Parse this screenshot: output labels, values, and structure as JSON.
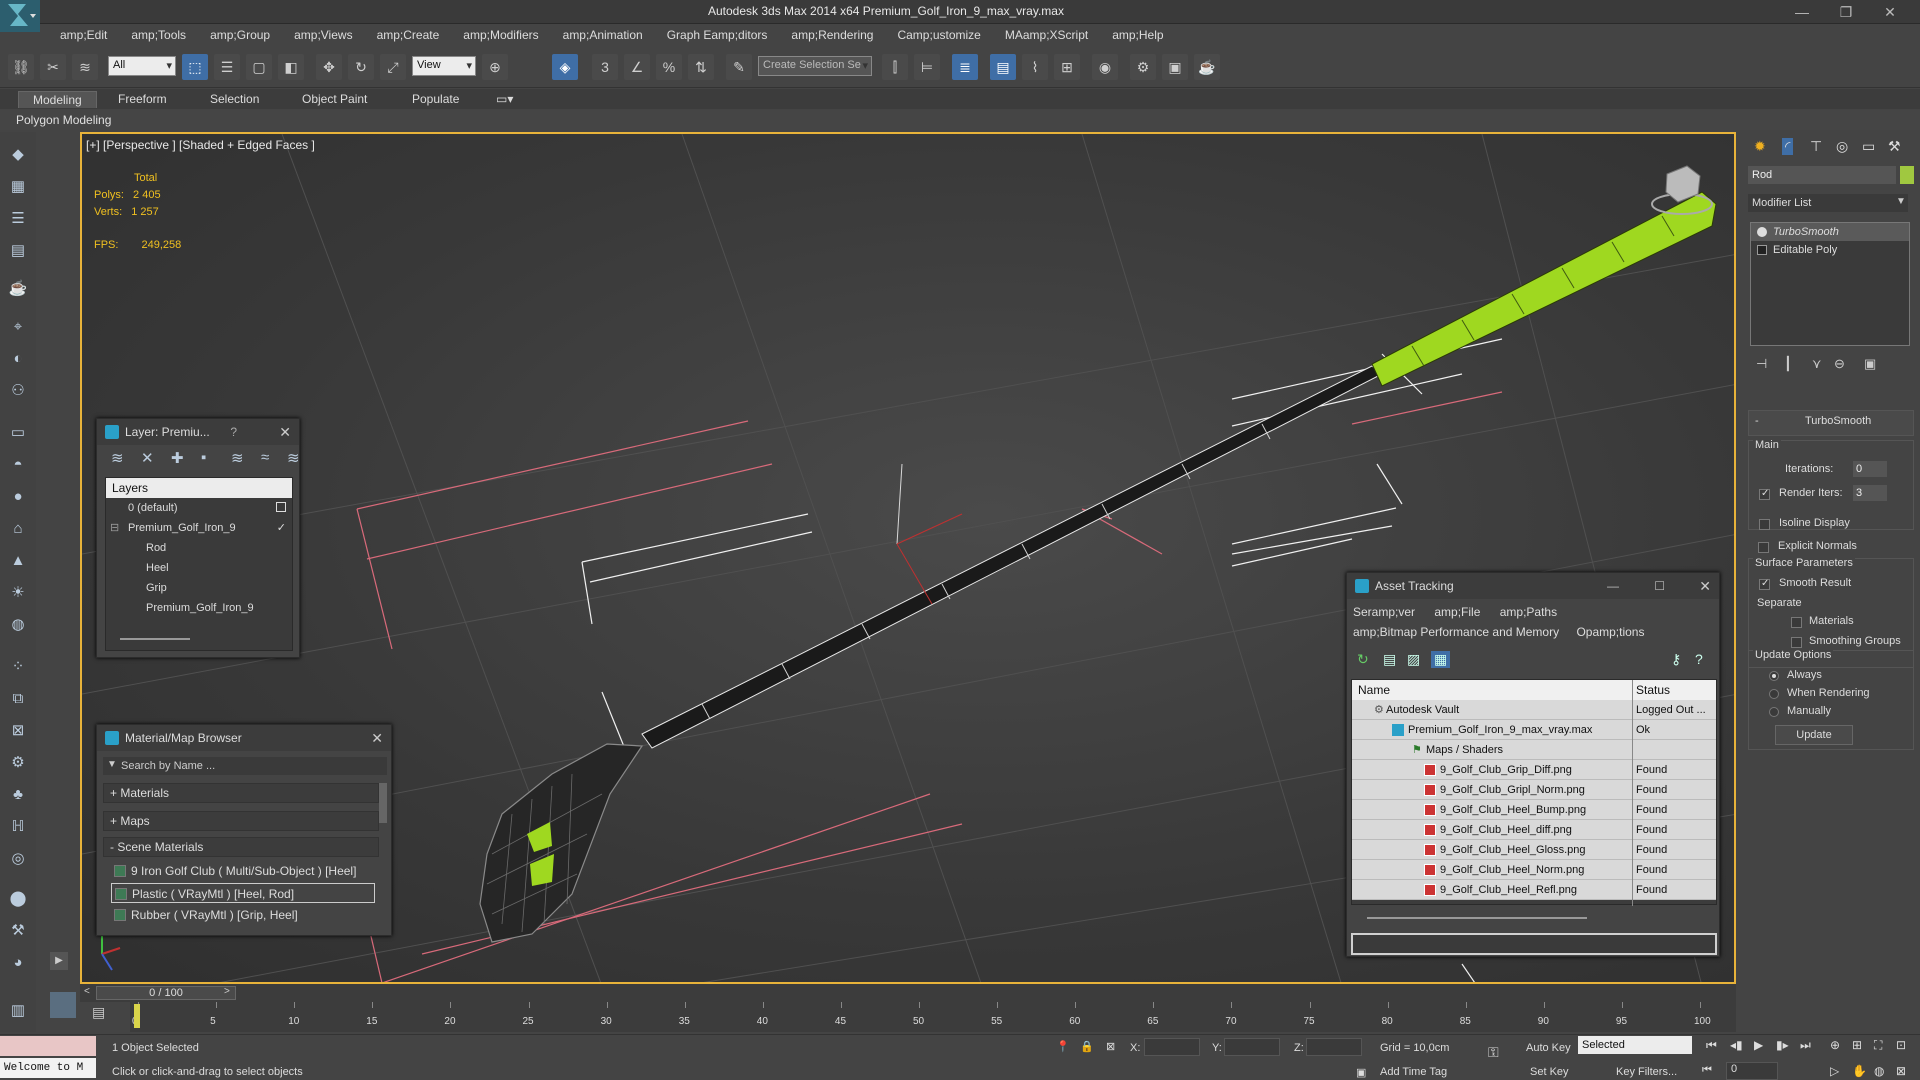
{
  "app": {
    "title": "Autodesk 3ds Max  2014 x64     Premium_Golf_Iron_9_max_vray.max",
    "window_controls": [
      "—",
      "❐",
      "✕"
    ]
  },
  "menu": [
    "amp;Edit",
    "amp;Tools",
    "amp;Group",
    "amp;Views",
    "amp;Create",
    "amp;Modifiers",
    "amp;Animation",
    "Graph Eamp;ditors",
    "amp;Rendering",
    "Camp;ustomize",
    "MAamp;XScript",
    "amp;Help"
  ],
  "toolbar": {
    "filter_value": "All",
    "view_value": "View",
    "selection_set_placeholder": "Create Selection Se"
  },
  "ribbon": {
    "tabs": [
      "Modeling",
      "Freeform",
      "Selection",
      "Object Paint",
      "Populate"
    ],
    "active_tab": "Modeling",
    "sub_label": "Polygon Modeling"
  },
  "viewport": {
    "label": "[+] [Perspective ] [Shaded + Edged Faces ]",
    "stats": {
      "total_label": "Total",
      "polys_label": "Polys:",
      "polys_value": "2 405",
      "verts_label": "Verts:",
      "verts_value": "1 257",
      "fps_label": "FPS:",
      "fps_value": "249,258"
    }
  },
  "layer_panel": {
    "title": "Layer: Premiu...",
    "help": "?",
    "header": "Layers",
    "rows": [
      {
        "label": "0 (default)",
        "indent": 1
      },
      {
        "label": "Premium_Golf_Iron_9",
        "indent": 1
      },
      {
        "label": "Rod",
        "indent": 2
      },
      {
        "label": "Heel",
        "indent": 2
      },
      {
        "label": "Grip",
        "indent": 2
      },
      {
        "label": "Premium_Golf_Iron_9",
        "indent": 2
      }
    ]
  },
  "material_browser": {
    "title": "Material/Map Browser",
    "search_placeholder": "Search by Name ...",
    "sections": [
      "+ Materials",
      "+ Maps",
      "- Scene Materials"
    ],
    "items": [
      "9 Iron Golf Club  ( Multi/Sub-Object ) [Heel]",
      "Plastic  ( VRayMtl ) [Heel, Rod]",
      "Rubber  ( VRayMtl ) [Grip, Heel]"
    ]
  },
  "asset_tracking": {
    "title": "Asset Tracking",
    "menu1": [
      "Seramp;ver",
      "amp;File",
      "amp;Paths"
    ],
    "menu2": [
      "amp;Bitmap Performance and Memory",
      "Opamp;tions"
    ],
    "col_name": "Name",
    "col_status": "Status",
    "rows": [
      {
        "name": "Autodesk Vault",
        "status": "Logged Out ...",
        "indent": 1
      },
      {
        "name": "Premium_Golf_Iron_9_max_vray.max",
        "status": "Ok",
        "indent": 2
      },
      {
        "name": "Maps / Shaders",
        "status": "",
        "indent": 3
      },
      {
        "name": "9_Golf_Club_Grip_Diff.png",
        "status": "Found",
        "indent": 4
      },
      {
        "name": "9_Golf_Club_Gripl_Norm.png",
        "status": "Found",
        "indent": 4
      },
      {
        "name": "9_Golf_Club_Heel_Bump.png",
        "status": "Found",
        "indent": 4
      },
      {
        "name": "9_Golf_Club_Heel_diff.png",
        "status": "Found",
        "indent": 4
      },
      {
        "name": "9_Golf_Club_Heel_Gloss.png",
        "status": "Found",
        "indent": 4
      },
      {
        "name": "9_Golf_Club_Heel_Norm.png",
        "status": "Found",
        "indent": 4
      },
      {
        "name": "9_Golf_Club_Heel_Refl.png",
        "status": "Found",
        "indent": 4
      }
    ]
  },
  "command_panel": {
    "object_name": "Rod",
    "modifier_list": "Modifier List",
    "stack": [
      "TurboSmooth",
      "Editable Poly"
    ],
    "turbosmooth": {
      "title": "TurboSmooth",
      "main": "Main",
      "iterations_label": "Iterations:",
      "iterations_value": "0",
      "render_iters_label": "Render Iters:",
      "render_iters_value": "3",
      "isoline": "Isoline Display",
      "explicit": "Explicit Normals",
      "surface_params": "Surface Parameters",
      "smooth_result": "Smooth Result",
      "separate": "Separate",
      "materials": "Materials",
      "smoothing_groups": "Smoothing Groups",
      "update_options": "Update Options",
      "always": "Always",
      "when_rendering": "When Rendering",
      "manually": "Manually",
      "update_btn": "Update"
    }
  },
  "timeline": {
    "frame": "0 / 100",
    "ticks": [
      "0",
      "5",
      "10",
      "15",
      "20",
      "25",
      "30",
      "35",
      "40",
      "45",
      "50",
      "55",
      "60",
      "65",
      "70",
      "75",
      "80",
      "85",
      "90",
      "95",
      "100"
    ]
  },
  "status": {
    "welcome": "Welcome to M",
    "selected_count": "1 Object Selected",
    "prompt": "Click or click-and-drag to select objects",
    "x_label": "X:",
    "y_label": "Y:",
    "z_label": "Z:",
    "grid": "Grid = 10,0cm",
    "add_time_tag": "Add Time Tag",
    "auto_key": "Auto Key",
    "set_key": "Set Key",
    "selected_dd": "Selected",
    "key_filters": "Key Filters...",
    "frame_value": "0"
  },
  "colors": {
    "viewport_border": "#e8b33a",
    "grip_green": "#9fd820",
    "wire": "#ffffff",
    "accent_blue": "#3f6ea6"
  }
}
